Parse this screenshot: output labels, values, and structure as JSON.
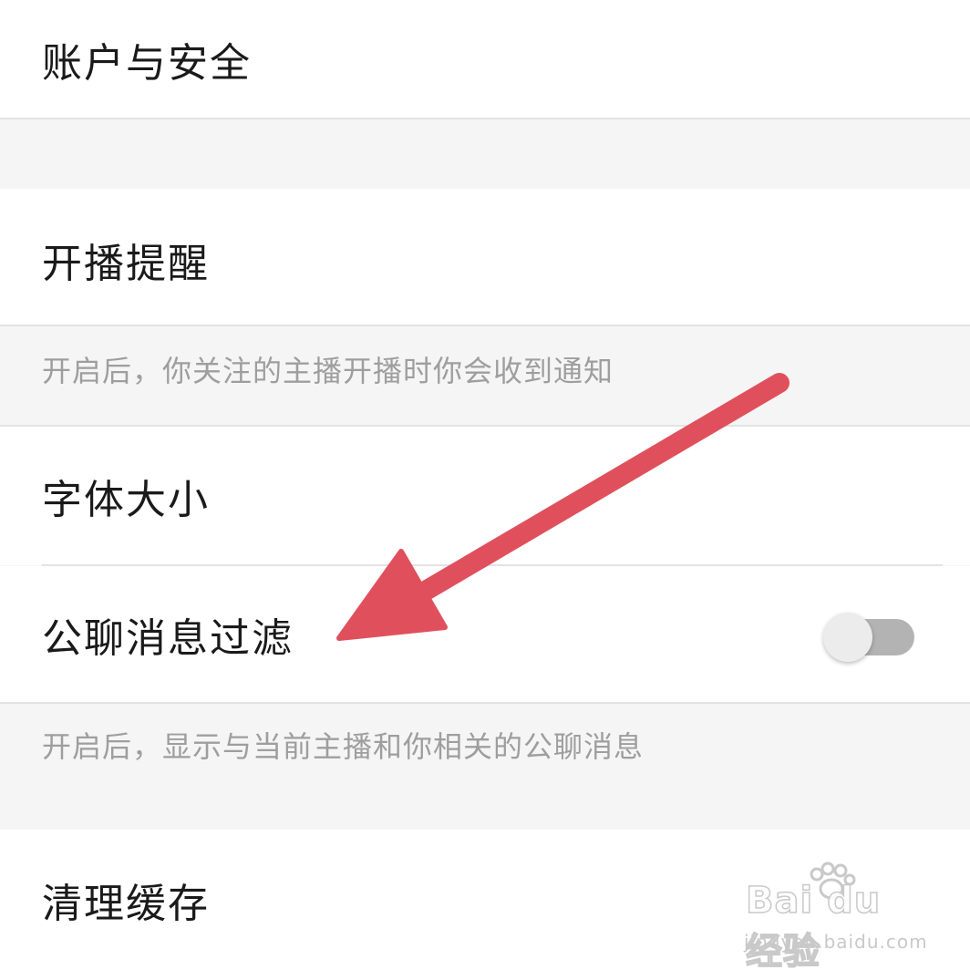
{
  "settings": {
    "account_security": {
      "label": "账户与安全"
    },
    "live_reminder": {
      "label": "开播提醒",
      "hint": "开启后，你关注的主播开播时你会收到通知"
    },
    "font_size": {
      "label": "字体大小"
    },
    "public_chat_filter": {
      "label": "公聊消息过滤",
      "enabled": false,
      "hint": "开启后，显示与当前主播和你相关的公聊消息"
    },
    "clear_cache": {
      "label": "清理缓存"
    }
  },
  "annotation": {
    "arrow_color": "#e0505c",
    "arrow_target": "public_chat_filter"
  },
  "watermark": {
    "logo": "Bai du 经验",
    "url": "jingyan.baidu.com"
  },
  "colors": {
    "background": "#f5f5f5",
    "row_background": "#ffffff",
    "label_text": "#1a1a1a",
    "hint_text": "#9e9e9e",
    "toggle_track": "#b3b3b3",
    "toggle_knob": "#ececec"
  }
}
